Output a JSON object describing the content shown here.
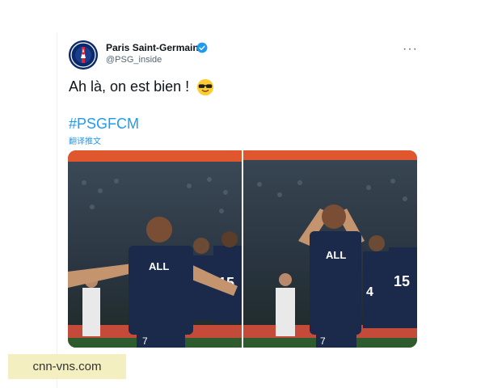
{
  "tweet": {
    "author_name": "Paris Saint-Germain",
    "author_handle": "@PSG_inside",
    "verified": true,
    "text": "Ah là, on est bien !",
    "emoji": "sunglasses-face",
    "hashtag": "#PSGFCM",
    "translate_label": "翻译推文",
    "more_label": "···"
  },
  "logo": {
    "top_text": "PARIS",
    "bottom_text": "SAINT-GERMAIN"
  },
  "media": {
    "photos": [
      {
        "description": "player-arms-out",
        "jersey_text": "ALL",
        "number": "7"
      },
      {
        "description": "player-hands-on-head",
        "jersey_text": "ALL",
        "number": "7"
      }
    ]
  },
  "watermark": {
    "text": "cnn-vns.com"
  },
  "colors": {
    "accent": "#1d9bf0",
    "psg_navy": "#1b2a4a",
    "text": "#0f1419",
    "secondary": "#536471"
  }
}
